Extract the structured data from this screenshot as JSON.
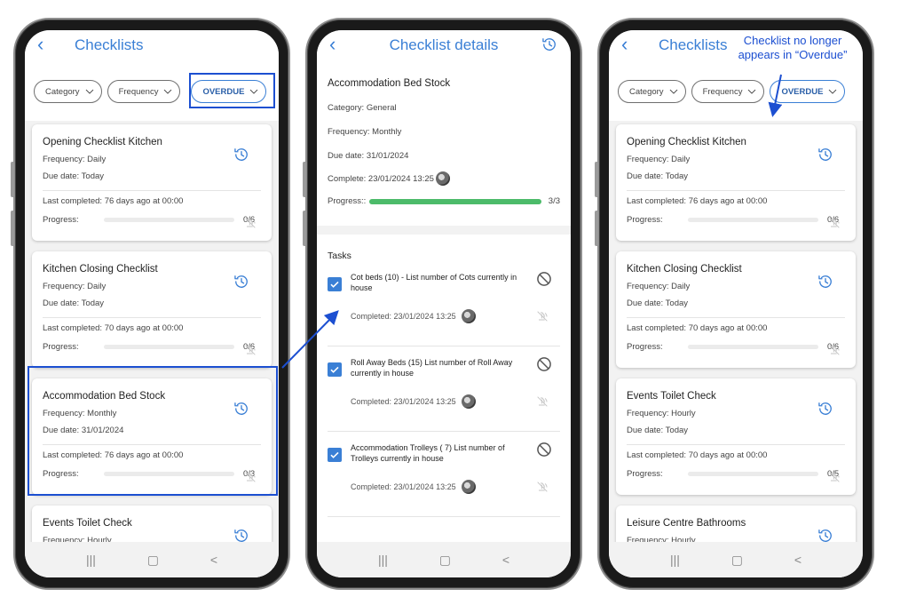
{
  "colors": {
    "accent": "#3a7fd5",
    "highlight": "#1c4fd1",
    "progress_green": "#4cbb6a"
  },
  "left_screen": {
    "title": "Checklists",
    "filters": [
      "Category",
      "Frequency",
      "OVERDUE"
    ],
    "cards": [
      {
        "title": "Opening Checklist Kitchen",
        "frequency": "Frequency: Daily",
        "due": "Due date: Today",
        "last": "Last completed: 76 days ago at 00:00",
        "progress_label": "Progress:",
        "count": "0/6"
      },
      {
        "title": "Kitchen Closing Checklist",
        "frequency": "Frequency: Daily",
        "due": "Due date: Today",
        "last": "Last completed: 70 days ago at 00:00",
        "progress_label": "Progress:",
        "count": "0/6"
      },
      {
        "title": "Accommodation Bed Stock",
        "frequency": "Frequency: Monthly",
        "due": "Due date: 31/01/2024",
        "last": "Last completed: 76 days ago at 00:00",
        "progress_label": "Progress:",
        "count": "0/3"
      },
      {
        "title": "Events Toilet Check",
        "frequency": "Frequency: Hourly"
      }
    ]
  },
  "middle_screen": {
    "title": "Checklist details",
    "name": "Accommodation Bed Stock",
    "category": "Category: General",
    "frequency": "Frequency: Monthly",
    "due": "Due date: 31/01/2024",
    "complete": "Complete: 23/01/2024 13:25",
    "progress_label": "Progress::",
    "progress_count": "3/3",
    "progress_value": 1.0,
    "tasks_heading": "Tasks",
    "tasks": [
      {
        "text": "Cot beds (10) - List number of Cots currently in house",
        "completed": "Completed: 23/01/2024 13:25"
      },
      {
        "text": "Roll Away Beds (15) List number of Roll Away currently in house",
        "completed": "Completed: 23/01/2024 13:25"
      },
      {
        "text": "Accommodation Trolleys ( 7) List number of Trolleys currently in house",
        "completed": "Completed: 23/01/2024 13:25"
      }
    ]
  },
  "right_screen": {
    "title": "Checklists",
    "filters": [
      "Category",
      "Frequency",
      "OVERDUE"
    ],
    "cards": [
      {
        "title": "Opening Checklist Kitchen",
        "frequency": "Frequency: Daily",
        "due": "Due date: Today",
        "last": "Last completed: 76 days ago at 00:00",
        "progress_label": "Progress:",
        "count": "0/6"
      },
      {
        "title": "Kitchen Closing Checklist",
        "frequency": "Frequency: Daily",
        "due": "Due date: Today",
        "last": "Last completed: 70 days ago at 00:00",
        "progress_label": "Progress:",
        "count": "0/6"
      },
      {
        "title": "Events Toilet Check",
        "frequency": "Frequency: Hourly",
        "due": "Due date: Today",
        "last": "Last completed: 70 days ago at 00:00",
        "progress_label": "Progress:",
        "count": "0/5"
      },
      {
        "title": "Leisure Centre Bathrooms",
        "frequency": "Frequency: Hourly"
      }
    ]
  },
  "annotation": {
    "line1": "Checklist no longer",
    "line2": "appears in “Overdue”"
  }
}
